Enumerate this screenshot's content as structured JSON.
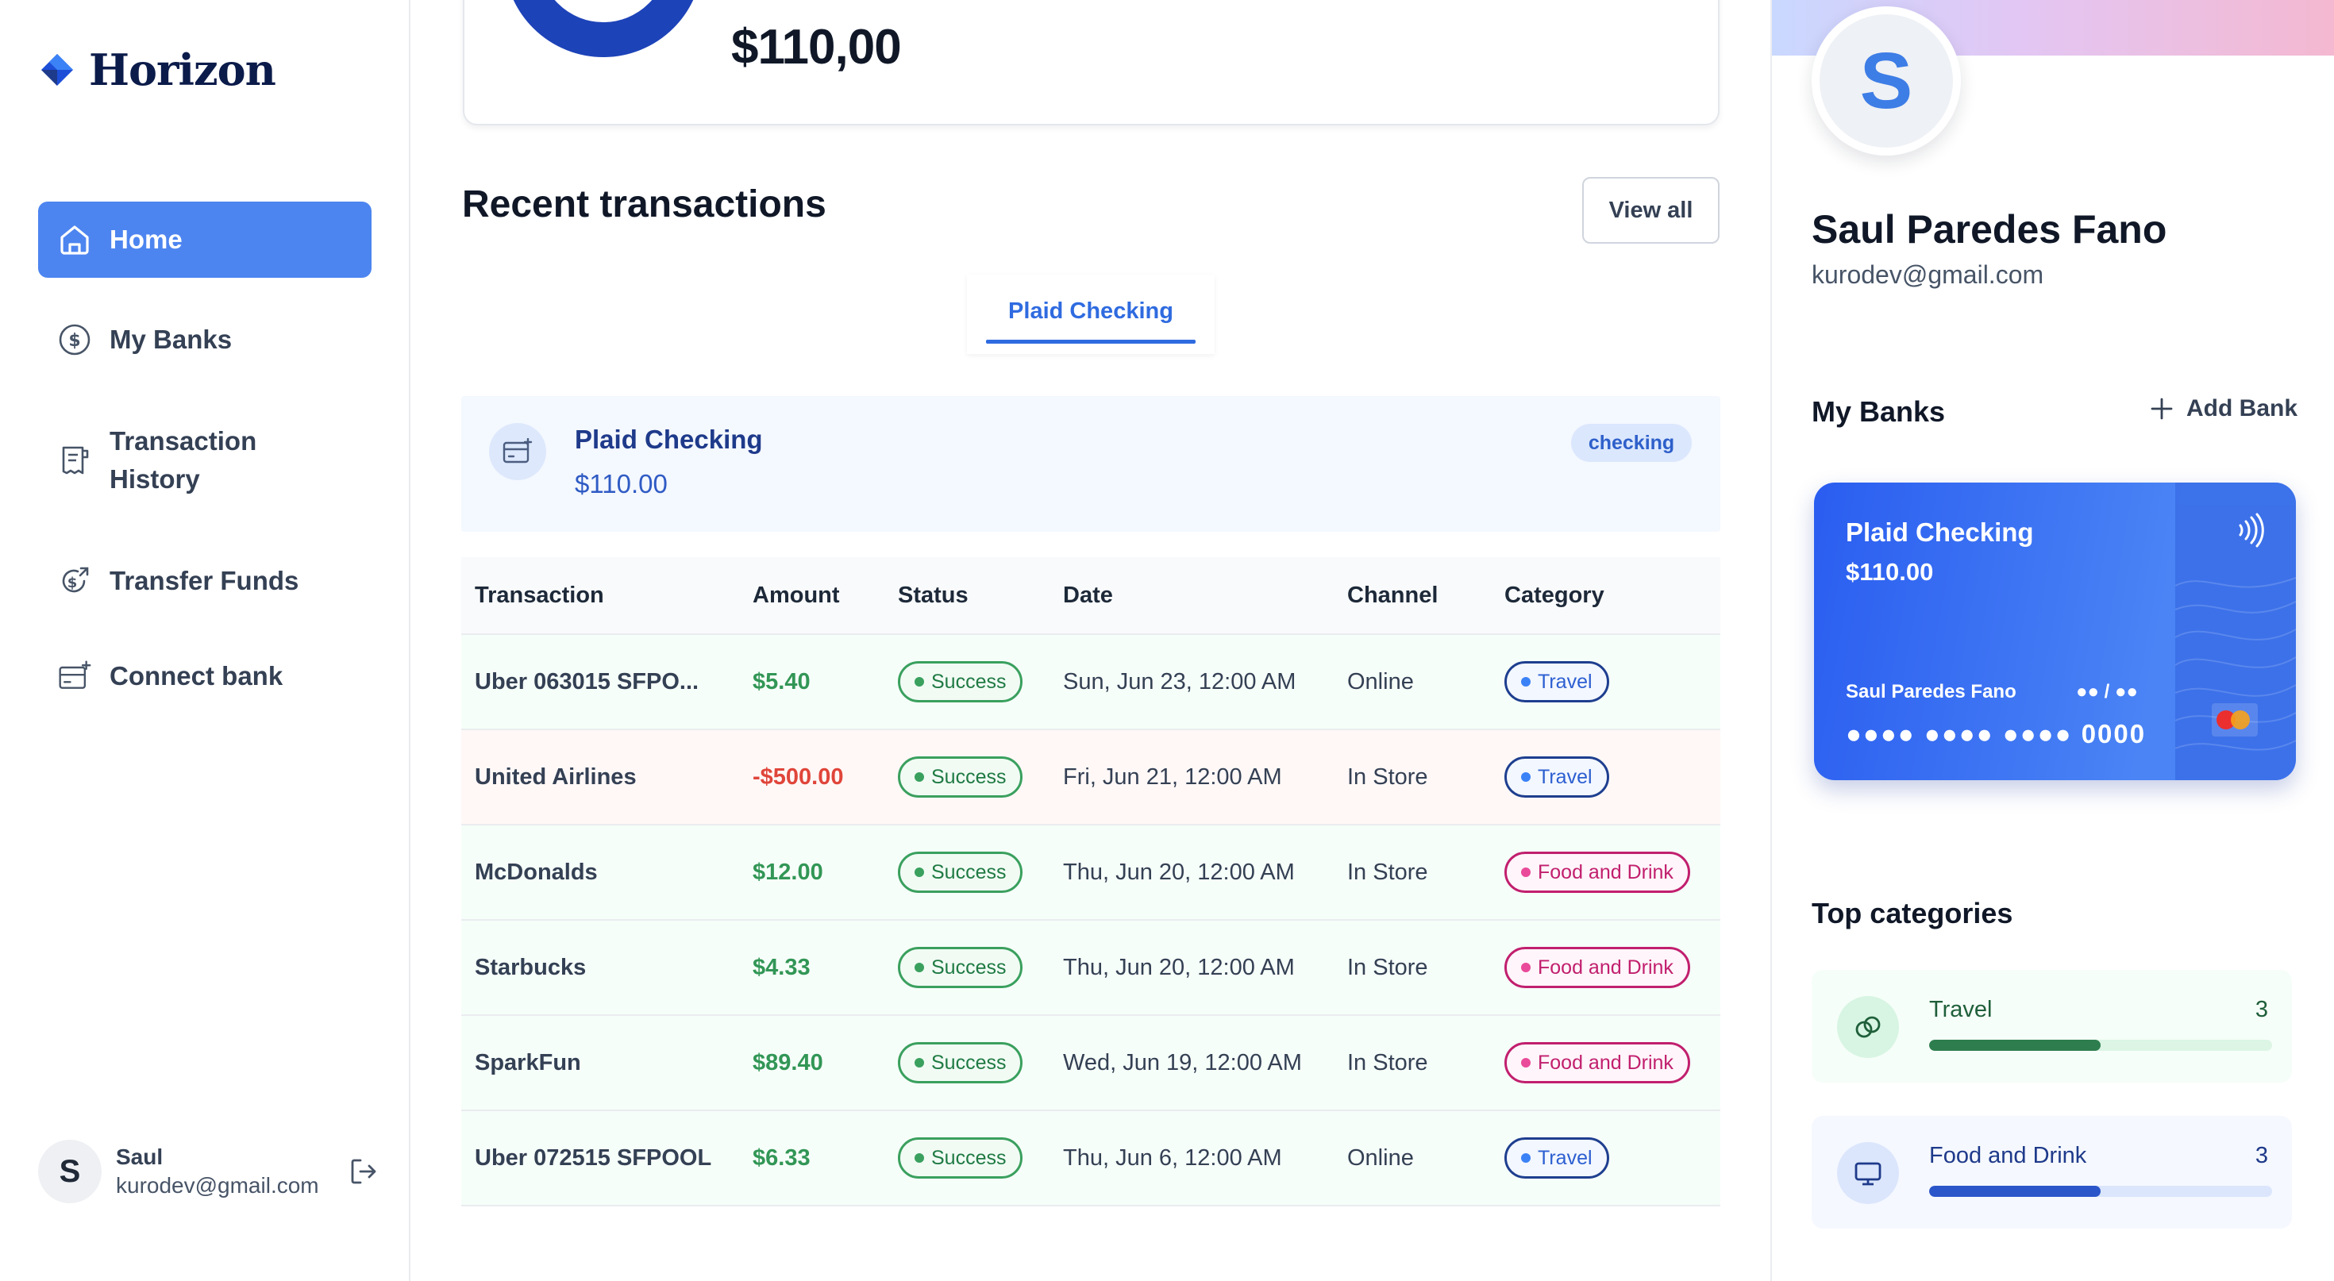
{
  "app": {
    "name": "Horizon"
  },
  "sidebar": {
    "items": [
      {
        "label": "Home",
        "icon": "home-icon",
        "active": true
      },
      {
        "label": "My Banks",
        "icon": "dollar-circle-icon",
        "active": false
      },
      {
        "label": "Transaction History",
        "icon": "receipt-icon",
        "active": false
      },
      {
        "label": "Transfer Funds",
        "icon": "money-send-icon",
        "active": false
      },
      {
        "label": "Connect bank",
        "icon": "card-add-icon",
        "active": false
      }
    ],
    "footer": {
      "initial": "S",
      "name": "Saul",
      "email": "kurodev@gmail.com"
    }
  },
  "balance": {
    "amount": "$110,00"
  },
  "transactions": {
    "title": "Recent transactions",
    "view_all": "View all",
    "tab": "Plaid Checking",
    "account": {
      "name": "Plaid Checking",
      "balance": "$110.00",
      "type": "checking"
    },
    "columns": [
      "Transaction",
      "Amount",
      "Status",
      "Date",
      "Channel",
      "Category"
    ],
    "rows": [
      {
        "name": "Uber 063015 SFPO...",
        "amount": "$5.40",
        "sign": "pos",
        "status": "Success",
        "date": "Sun, Jun 23, 12:00 AM",
        "channel": "Online",
        "category": "Travel"
      },
      {
        "name": "United Airlines",
        "amount": "-$500.00",
        "sign": "neg",
        "status": "Success",
        "date": "Fri, Jun 21, 12:00 AM",
        "channel": "In Store",
        "category": "Travel"
      },
      {
        "name": "McDonalds",
        "amount": "$12.00",
        "sign": "pos",
        "status": "Success",
        "date": "Thu, Jun 20, 12:00 AM",
        "channel": "In Store",
        "category": "Food and Drink"
      },
      {
        "name": "Starbucks",
        "amount": "$4.33",
        "sign": "pos",
        "status": "Success",
        "date": "Thu, Jun 20, 12:00 AM",
        "channel": "In Store",
        "category": "Food and Drink"
      },
      {
        "name": "SparkFun",
        "amount": "$89.40",
        "sign": "pos",
        "status": "Success",
        "date": "Wed, Jun 19, 12:00 AM",
        "channel": "In Store",
        "category": "Food and Drink"
      },
      {
        "name": "Uber 072515 SFPOOL",
        "amount": "$6.33",
        "sign": "pos",
        "status": "Success",
        "date": "Thu, Jun 6, 12:00 AM",
        "channel": "Online",
        "category": "Travel"
      }
    ]
  },
  "profile": {
    "initial": "S",
    "name": "Saul Paredes Fano",
    "email": "kurodev@gmail.com"
  },
  "my_banks": {
    "title": "My Banks",
    "add_label": "Add Bank",
    "card": {
      "name": "Plaid Checking",
      "balance": "$110.00",
      "holder": "Saul Paredes Fano",
      "expiry": "●● / ●●",
      "number": "●●●● ●●●● ●●●● 0000"
    }
  },
  "top_categories": {
    "title": "Top categories",
    "items": [
      {
        "name": "Travel",
        "count": "3",
        "fill_fraction": 0.5,
        "icon": "link-circles-icon",
        "color": "#2e7d4e"
      },
      {
        "name": "Food and Drink",
        "count": "3",
        "fill_fraction": 0.5,
        "icon": "monitor-icon",
        "color": "#2b56c9"
      }
    ]
  },
  "colors": {
    "accent": "#4d85f0",
    "success": "#329656",
    "negative": "#e0453a",
    "travel": "#1e3f8f",
    "food": "#c11f6e"
  }
}
